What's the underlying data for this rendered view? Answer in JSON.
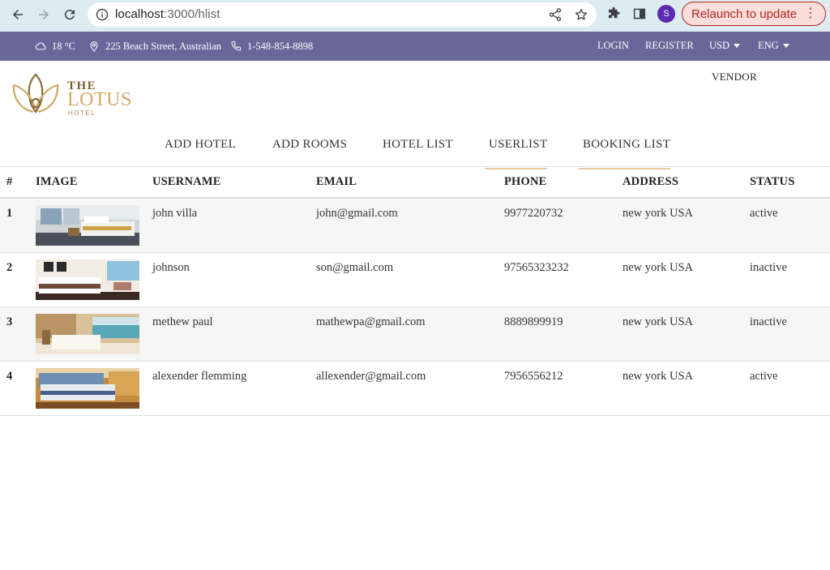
{
  "browser": {
    "url_host": "localhost",
    "url_rest": ":3000/hlist",
    "profile_initial": "S",
    "relaunch_label": "Relaunch to update"
  },
  "topbar": {
    "weather": "18 °C",
    "address": "225 Beach Street, Australian",
    "phone": "1-548-854-8898",
    "login": "LOGIN",
    "register": "REGISTER",
    "currency": "USD",
    "language": "ENG"
  },
  "header": {
    "logo_the": "THE",
    "logo_lotus": "LOTUS",
    "logo_hotel": "HOTEL",
    "vendor": "VENDOR"
  },
  "nav": {
    "items": [
      {
        "label": "ADD HOTEL"
      },
      {
        "label": "ADD ROOMS"
      },
      {
        "label": "HOTEL LIST"
      },
      {
        "label": "USERLIST"
      },
      {
        "label": "BOOKING LIST"
      }
    ]
  },
  "table": {
    "headers": {
      "idx": "#",
      "image": "IMAGE",
      "username": "USERNAME",
      "email": "EMAIL",
      "phone": "PHONE",
      "address": "ADDRESS",
      "status": "STATUS"
    },
    "rows": [
      {
        "idx": "1",
        "username": "john villa",
        "email": "john@gmail.com",
        "phone": "9977220732",
        "address": "new york USA",
        "status": "active"
      },
      {
        "idx": "2",
        "username": "johnson",
        "email": "son@gmail.com",
        "phone": "97565323232",
        "address": "new york USA",
        "status": "inactive"
      },
      {
        "idx": "3",
        "username": "methew paul",
        "email": "mathewpa@gmail.com",
        "phone": "8889899919",
        "address": "new york USA",
        "status": "inactive"
      },
      {
        "idx": "4",
        "username": "alexender flemming",
        "email": "allexender@gmail.com",
        "phone": "7956556212",
        "address": "new york USA",
        "status": "active"
      }
    ]
  },
  "colors": {
    "topbar": "#6b6699",
    "nav_underline": "#e8c9a0",
    "logo_gold": "#d1a866"
  }
}
